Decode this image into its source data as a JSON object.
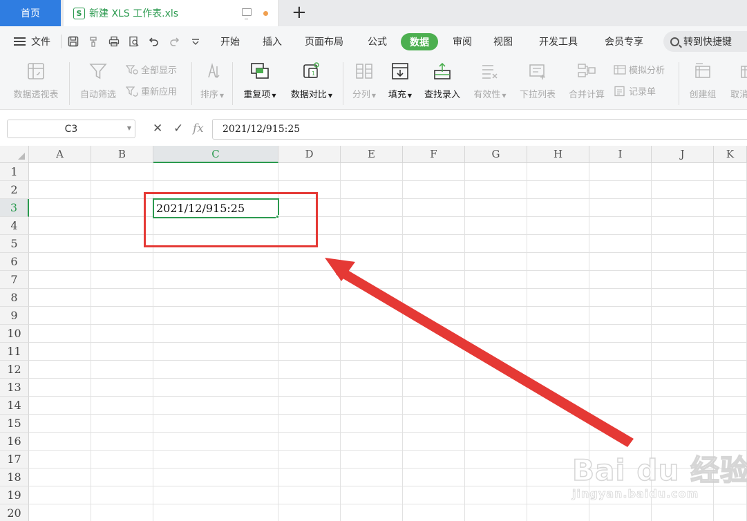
{
  "tabs": {
    "home": "首页",
    "file": "新建 XLS 工作表.xls",
    "file_icon": "S"
  },
  "menu": {
    "file": "文件",
    "items": [
      "开始",
      "插入",
      "页面布局",
      "公式",
      "数据",
      "审阅",
      "视图",
      "开发工具",
      "会员专享"
    ],
    "active": "数据",
    "search": "转到快捷键"
  },
  "ribbon": {
    "pivot": "数据透视表",
    "autofilter": "自动筛选",
    "show_all": "全部显示",
    "reapply": "重新应用",
    "sort": "排序",
    "duplicates": "重复项",
    "compare": "数据对比",
    "split": "分列",
    "fill": "填充",
    "lookup": "查找录入",
    "validity": "有效性",
    "dropdown": "下拉列表",
    "consolidate": "合并计算",
    "whatif": "模拟分析",
    "record": "记录单",
    "group": "创建组",
    "ungroup": "取消"
  },
  "formula_bar": {
    "name_box": "C3",
    "value": "2021/12/915:25",
    "fx": "fx"
  },
  "sheet": {
    "columns": [
      "A",
      "B",
      "C",
      "D",
      "E",
      "F",
      "G",
      "H",
      "I",
      "J",
      "K"
    ],
    "rows": [
      "1",
      "2",
      "3",
      "4",
      "5",
      "6",
      "7",
      "8",
      "9",
      "10",
      "11",
      "12",
      "13",
      "14",
      "15",
      "16",
      "17",
      "18",
      "19",
      "20"
    ],
    "selected_col": "C",
    "selected_row": "3",
    "cell_c3": "2021/12/915:25"
  },
  "watermark": {
    "main": "Bai du 经验",
    "sub": "jingyan.baidu.com"
  },
  "colors": {
    "accent_green": "#2b9a4f",
    "tab_blue": "#2f7de1",
    "annotation_red": "#e53935"
  }
}
